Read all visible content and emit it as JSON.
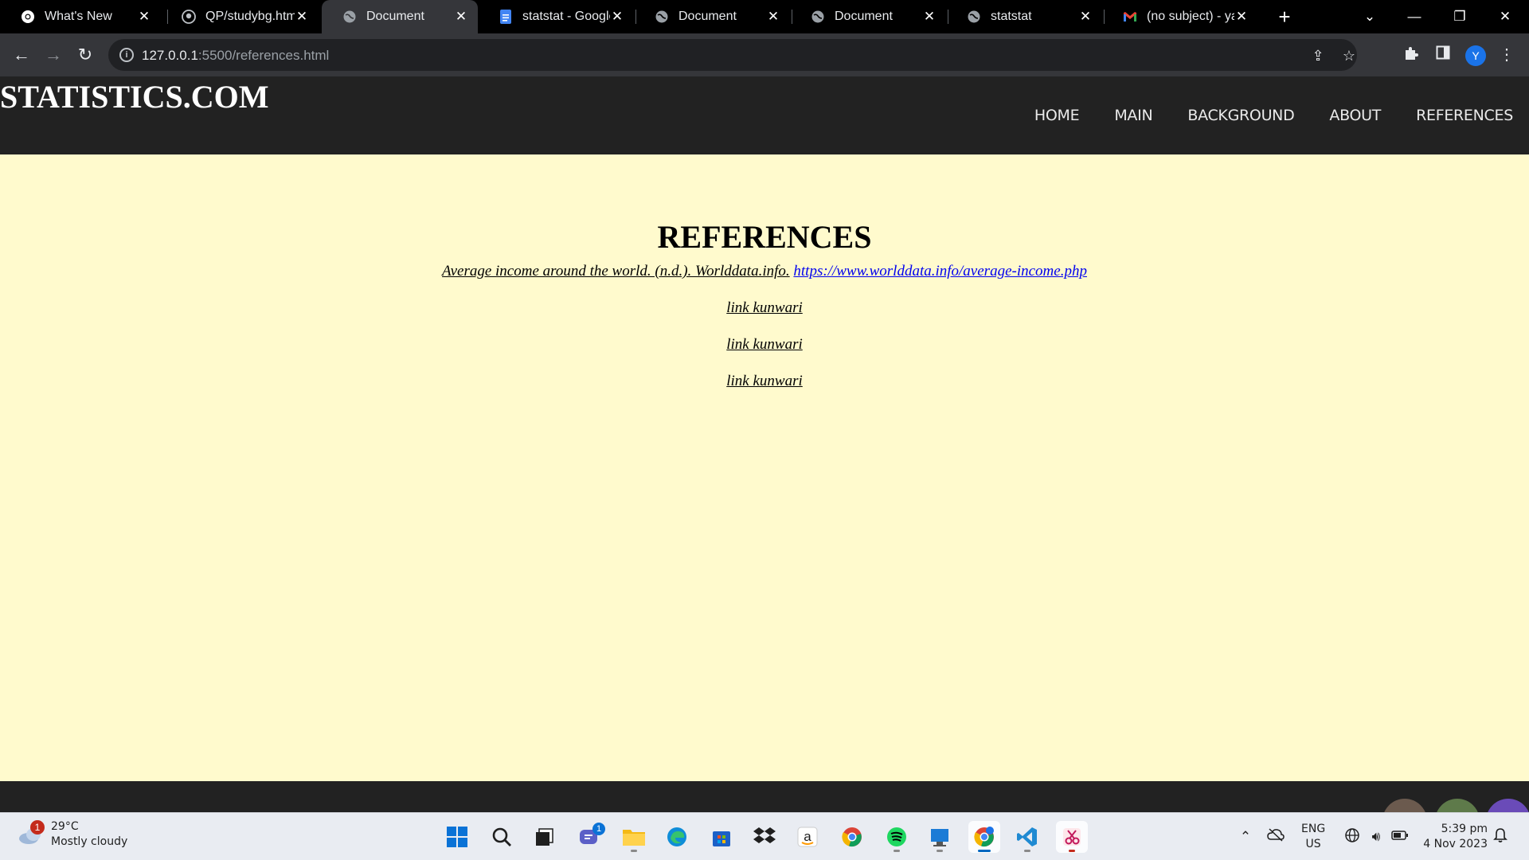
{
  "browser": {
    "tabs": [
      {
        "title": "What's New",
        "icon": "chrome-icon"
      },
      {
        "title": "QP/studybg.html",
        "icon": "github-icon"
      },
      {
        "title": "Document",
        "icon": "globe-icon",
        "active": true
      },
      {
        "title": "statstat - Google",
        "icon": "google-docs-icon"
      },
      {
        "title": "Document",
        "icon": "globe-icon"
      },
      {
        "title": "Document",
        "icon": "globe-icon"
      },
      {
        "title": "statstat",
        "icon": "globe-icon"
      },
      {
        "title": "(no subject) - yas",
        "icon": "gmail-icon"
      }
    ],
    "url_host": "127.0.0.1",
    "url_rest": ":5500/references.html",
    "profile_initial": "Y"
  },
  "site": {
    "logo": "STATISTICS.COM",
    "nav": [
      "HOME",
      "MAIN",
      "BACKGROUND",
      "ABOUT",
      "REFERENCES"
    ],
    "heading": "REFERENCES",
    "reference_citation": "Average income around the world. (n.d.). Worlddata.info.",
    "reference_url": "https://www.worlddata.info/average-income.php",
    "extra_links": [
      "link kunwari",
      "link kunwari",
      "link kunwari"
    ],
    "colors": {
      "header_bg": "#222222",
      "page_bg": "#fffacd",
      "link": "#0000ee"
    }
  },
  "taskbar": {
    "weather_badge": "1",
    "temperature": "29°C",
    "condition": "Mostly cloudy",
    "chat_badge": "1",
    "language_top": "ENG",
    "language_bottom": "US",
    "time": "5:39 pm",
    "date": "4 Nov 2023"
  }
}
